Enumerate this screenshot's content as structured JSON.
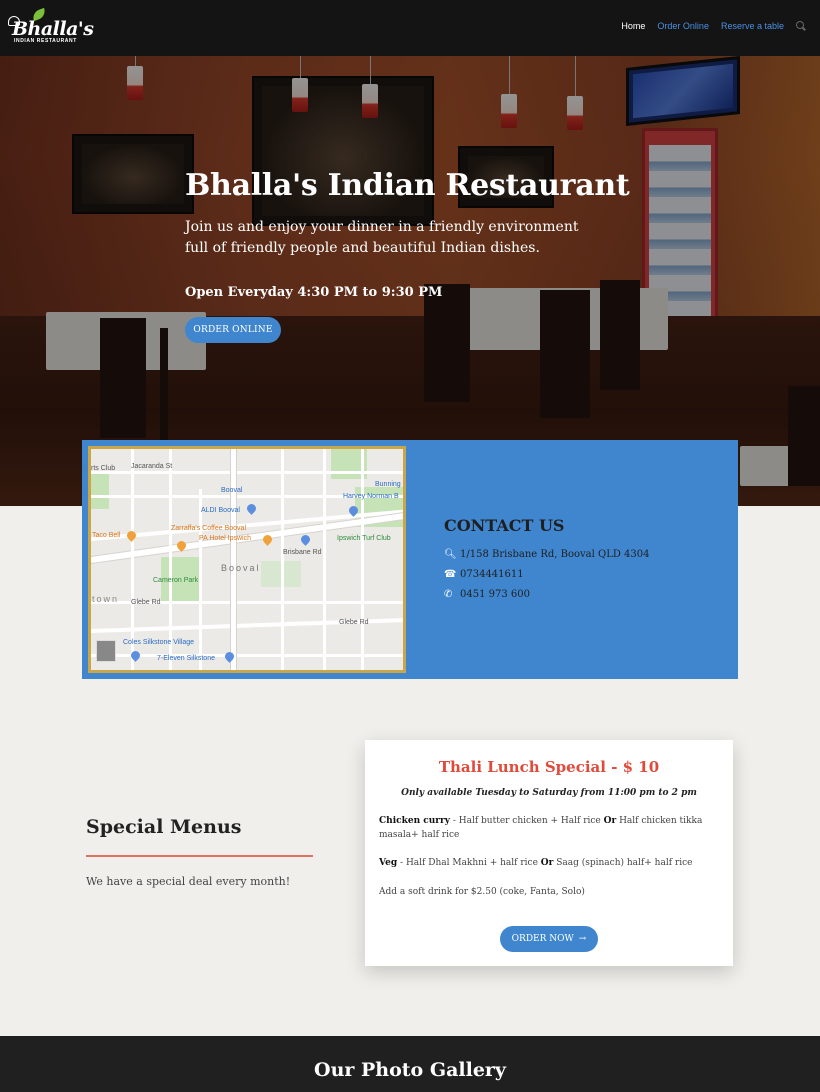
{
  "brand": {
    "logo_name": "Bhalla's",
    "logo_sub": "INDIAN RESTAURANT"
  },
  "nav": {
    "items": [
      {
        "label": "Home",
        "active": true
      },
      {
        "label": "Order Online",
        "active": false
      },
      {
        "label": "Reserve a table",
        "active": false
      }
    ],
    "search_icon": "search-icon"
  },
  "hero": {
    "title": "Bhalla's Indian Restaurant",
    "subtitle": "Join us and enjoy your dinner in a friendly environment full of friendly people and beautiful Indian dishes.",
    "hours": "Open Everyday 4:30 PM to 9:30 PM",
    "button": "ORDER ONLINE"
  },
  "map": {
    "labels": {
      "jacaranda": "Jacaranda St",
      "booval": "Booval",
      "aldi": "ALDI Booval",
      "bunnings": "Bunning",
      "harvey": "Harvey Norman B",
      "taco": "Taco Bell",
      "zarraffa": "Zarraffa's Coffee Booval",
      "pa_hotel": "PA Hotel Ipswich",
      "turf": "Ipswich Turf Club",
      "brisbane_rd": "Brisbane Rd",
      "booval_area": "Booval",
      "cameron": "Cameron Park",
      "glebe": "Glebe Rd",
      "coles": "Coles Silkstone Village",
      "seven": "7-Eleven Silkstone",
      "rts": "rts Club",
      "town": "town"
    }
  },
  "contact": {
    "title": "CONTACT US",
    "address": "1/158 Brisbane Rd, Booval QLD 4304",
    "phone1": "0734441611",
    "phone2": "0451 973 600"
  },
  "special": {
    "title": "Special Menus",
    "text": "We have a special deal every month!"
  },
  "card": {
    "title": "Thali Lunch Special - $ 10",
    "subtitle": "Only available Tuesday to Saturday from 11:00 pm to 2 pm",
    "chicken_label": "Chicken curry",
    "chicken_a": " - Half butter chicken + Half rice ",
    "or1": "Or",
    "chicken_b": " Half chicken tikka masala+ half rice",
    "veg_label": "Veg",
    "veg_a": " - Half Dhal Makhni + half rice ",
    "or2": "Or",
    "veg_b": " Saag (spinach) half+ half rice",
    "drink": "Add a soft drink for $2.50 (coke, Fanta, Solo)",
    "button": "ORDER NOW",
    "button_arrow": "→"
  },
  "gallery": {
    "title": "Our Photo Gallery"
  }
}
